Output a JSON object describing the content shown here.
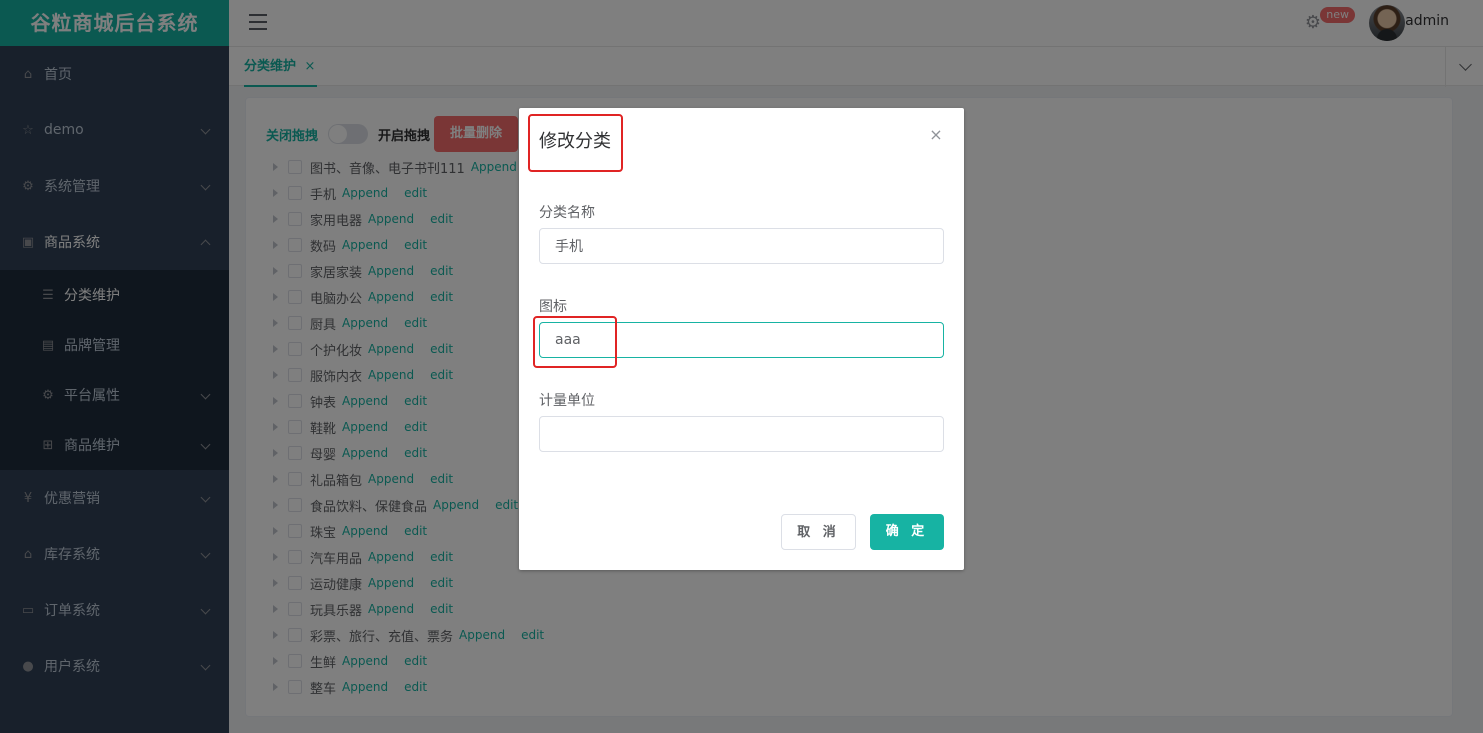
{
  "app": {
    "title": "谷粒商城后台系统",
    "username": "admin",
    "badge": "new"
  },
  "sidebar": {
    "items": [
      {
        "label": "首页",
        "icon": "home-icon"
      },
      {
        "label": "demo",
        "icon": "star-icon"
      },
      {
        "label": "系统管理",
        "icon": "gear-icon"
      },
      {
        "label": "商品系统",
        "icon": "product-icon"
      },
      {
        "label": "优惠营销",
        "icon": "coupon-icon"
      },
      {
        "label": "库存系统",
        "icon": "warehouse-icon"
      },
      {
        "label": "订单系统",
        "icon": "order-icon"
      },
      {
        "label": "用户系统",
        "icon": "user-icon"
      }
    ],
    "sub_items": [
      {
        "label": "分类维护",
        "icon": "list-icon"
      },
      {
        "label": "品牌管理",
        "icon": "brand-icon"
      },
      {
        "label": "平台属性",
        "icon": "gear-icon"
      },
      {
        "label": "商品维护",
        "icon": "grid-icon"
      }
    ]
  },
  "tags": {
    "active_label": "分类维护",
    "close": "×"
  },
  "toolbar": {
    "drag_off": "关闭拖拽",
    "drag_on": "开启拖拽",
    "batch_delete": "批量删除"
  },
  "tree": {
    "append_label": "Append",
    "edit_label": "edit",
    "nodes": [
      "图书、音像、电子书刊111",
      "手机",
      "家用电器",
      "数码",
      "家居家装",
      "电脑办公",
      "厨具",
      "个护化妆",
      "服饰内衣",
      "钟表",
      "鞋靴",
      "母婴",
      "礼品箱包",
      "食品饮料、保健食品",
      "珠宝",
      "汽车用品",
      "运动健康",
      "玩具乐器",
      "彩票、旅行、充值、票务",
      "生鲜",
      "整车"
    ]
  },
  "dialog": {
    "title": "修改分类",
    "close": "×",
    "name_label": "分类名称",
    "name_value": "手机",
    "icon_label": "图标",
    "icon_value": "aaa",
    "unit_label": "计量单位",
    "unit_value": "",
    "cancel_label": "取 消",
    "confirm_label": "确 定"
  },
  "colors": {
    "accent": "#17b3a3",
    "danger": "#f56c6c",
    "sidebar_bg": "#304156",
    "highlight": "#e02424"
  }
}
